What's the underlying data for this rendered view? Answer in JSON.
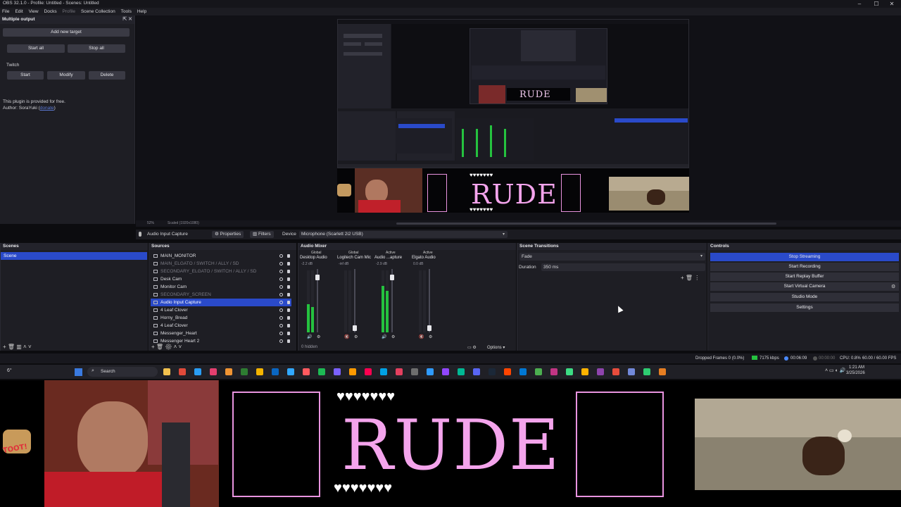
{
  "window": {
    "title": "OBS 32.1.0 - Profile: Untitled - Scenes: Untitled",
    "minimize": "–",
    "maximize": "☐",
    "close": "✕"
  },
  "menu": {
    "items": [
      "File",
      "Edit",
      "View",
      "Docks",
      "Profile",
      "Scene Collection",
      "Tools",
      "Help"
    ]
  },
  "multiple_output": {
    "title": "Multiple output",
    "add_target": "Add new target",
    "start_all": "Start all",
    "stop_all": "Stop all",
    "target_name": "Twitch",
    "start": "Start",
    "modify": "Modify",
    "delete": "Delete",
    "note_line1": "This plugin is provided for free.",
    "note_line2": "Author: SoraYuki (",
    "donate_link": "donate",
    "note_end": ")"
  },
  "preview": {
    "zoom": "52%",
    "scaled": "Scaled (1920x1080)",
    "overlay_title": "RUDE"
  },
  "properties_bar": {
    "source_name": "Audio Input Capture",
    "properties": "Properties",
    "filters": "Filters",
    "device_label": "Device",
    "device_value": "Microphone (Scarlett 2i2 USB)"
  },
  "scenes": {
    "title": "Scenes",
    "items": [
      "Scene"
    ]
  },
  "sources": {
    "title": "Sources",
    "items": [
      {
        "label": "MAIN_MONITOR",
        "dim": false
      },
      {
        "label": "MAIN_ELGATO / SWITCH / ALLY / SD",
        "dim": true
      },
      {
        "label": "SECONDARY_ELGATO / SWITCH / ALLY / SD",
        "dim": true
      },
      {
        "label": "Desk Cam",
        "dim": false
      },
      {
        "label": "Monitor Cam",
        "dim": false
      },
      {
        "label": "SECONDARY_SCREEN",
        "dim": true
      },
      {
        "label": "Audio Input Capture",
        "dim": false
      },
      {
        "label": "4 Leaf Clover",
        "dim": false
      },
      {
        "label": "Horny_Bread",
        "dim": false
      },
      {
        "label": "4 Leaf Clover",
        "dim": false
      },
      {
        "label": "Messenger_Heart",
        "dim": false
      },
      {
        "label": "Messenger Heart 2",
        "dim": false
      }
    ]
  },
  "mixer": {
    "title": "Audio Mixer",
    "channels": [
      {
        "tag": "Global",
        "name": "Desktop Audio",
        "db": "-2.2 dB",
        "level": 0.45,
        "muted": false
      },
      {
        "tag": "Global",
        "name": "Logitech Cam Mic",
        "db": "-inf dB",
        "level": 0.0,
        "muted": true
      },
      {
        "tag": "Active",
        "name": "Audio ...apture",
        "db": "-2.9 dB",
        "level": 0.75,
        "muted": false
      },
      {
        "tag": "Active",
        "name": "Elgato Audio",
        "db": "0.0 dB",
        "level": 0.0,
        "muted": true
      }
    ],
    "hidden": "0 hidden",
    "options": "Options"
  },
  "transitions": {
    "title": "Scene Transitions",
    "selected": "Fade",
    "duration_label": "Duration",
    "duration_value": "350 ms"
  },
  "controls": {
    "title": "Controls",
    "stop_streaming": "Stop Streaming",
    "start_recording": "Start Recording",
    "start_replay": "Start Replay Buffer",
    "start_virtual": "Start Virtual Camera",
    "studio_mode": "Studio Mode",
    "settings": "Settings"
  },
  "status": {
    "dropped": "Dropped Frames 0 (0.0%)",
    "kbps": "7175 kbps",
    "stream_time": "00:06:09",
    "rec_time": "00:00:00",
    "cpu": "CPU: 0.8%",
    "fps": "60.00 / 60.00 FPS"
  },
  "taskbar": {
    "temp": "6°",
    "search": "Search",
    "time": "1:21 AM",
    "date": "3/25/2026"
  },
  "overlay": {
    "title": "RUDE",
    "sticker": "TOOT!"
  },
  "colors": {
    "accent": "#2a4ac9",
    "overlay_pink": "#f4a4ec",
    "meter_green": "#25c23f"
  }
}
